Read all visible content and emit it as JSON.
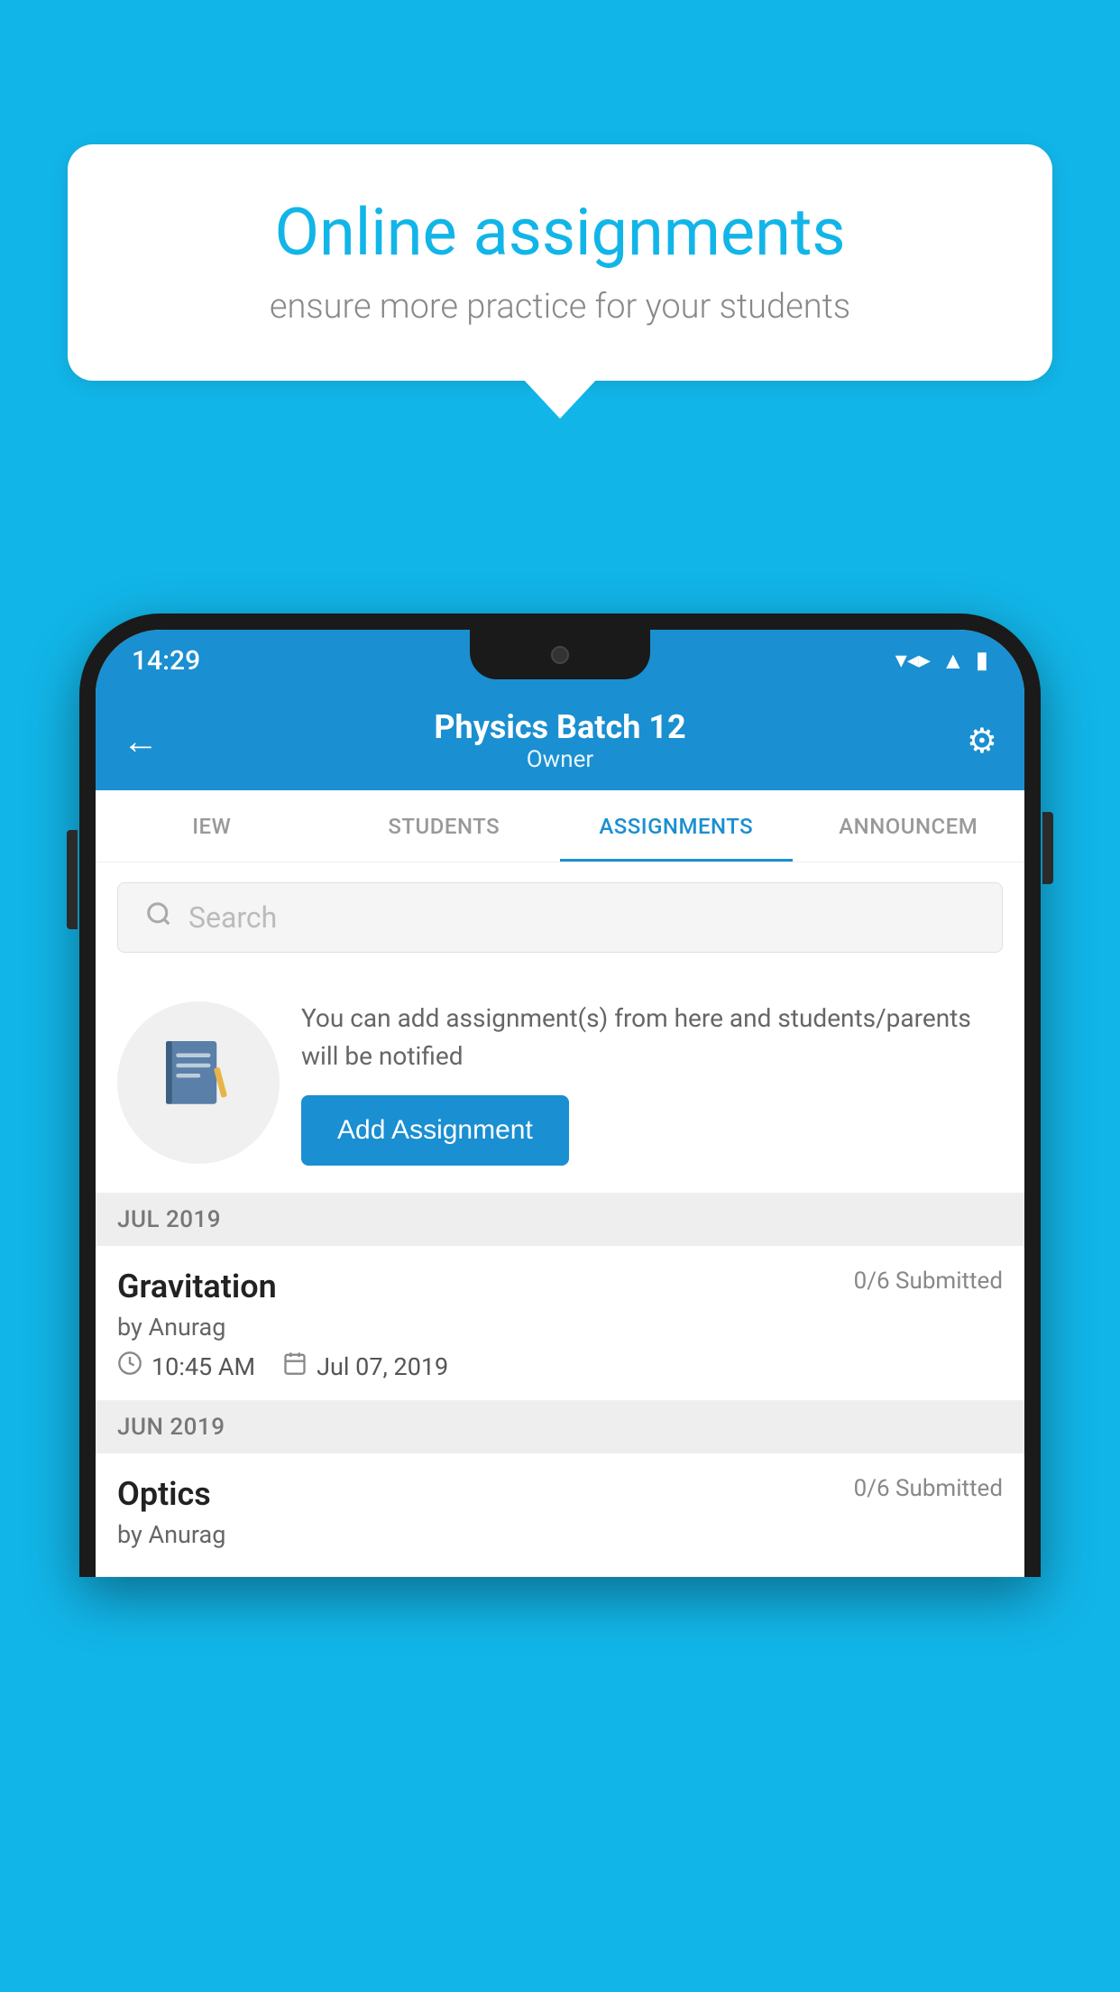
{
  "background_color": "#12b5e8",
  "bubble": {
    "title": "Online assignments",
    "subtitle": "ensure more practice for your students"
  },
  "phone": {
    "status_bar": {
      "time": "14:29",
      "icons": [
        "wifi",
        "signal",
        "battery"
      ]
    },
    "app_bar": {
      "title": "Physics Batch 12",
      "subtitle": "Owner",
      "back_label": "←",
      "settings_label": "⚙"
    },
    "tabs": [
      {
        "label": "IEW",
        "active": false
      },
      {
        "label": "STUDENTS",
        "active": false
      },
      {
        "label": "ASSIGNMENTS",
        "active": true
      },
      {
        "label": "ANNOUNCEM",
        "active": false
      }
    ],
    "search": {
      "placeholder": "Search"
    },
    "add_section": {
      "description": "You can add assignment(s) from here and students/parents will be notified",
      "button_label": "Add Assignment"
    },
    "sections": [
      {
        "month": "JUL 2019",
        "assignments": [
          {
            "title": "Gravitation",
            "submitted": "0/6 Submitted",
            "author": "by Anurag",
            "time": "10:45 AM",
            "date": "Jul 07, 2019"
          }
        ]
      },
      {
        "month": "JUN 2019",
        "assignments": [
          {
            "title": "Optics",
            "submitted": "0/6 Submitted",
            "author": "by Anurag",
            "time": "",
            "date": ""
          }
        ]
      }
    ]
  }
}
